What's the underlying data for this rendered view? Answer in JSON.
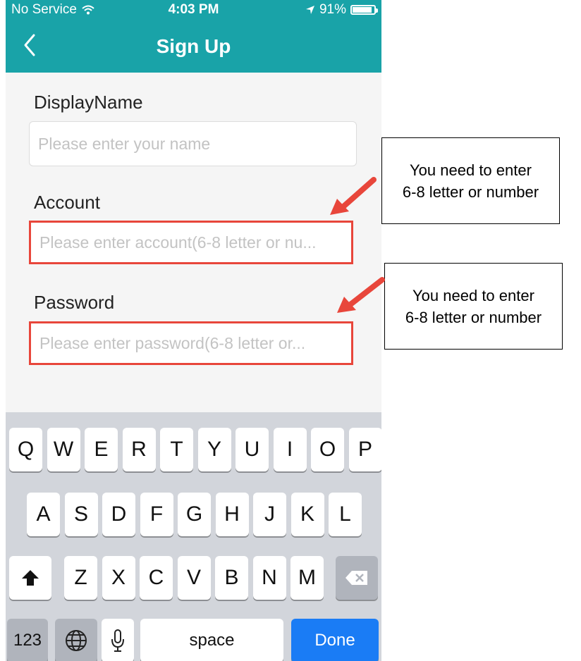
{
  "status_bar": {
    "carrier": "No Service",
    "time": "4:03 PM",
    "battery": "91%",
    "battery_level": 0.91
  },
  "nav": {
    "title": "Sign Up"
  },
  "form": {
    "display_name": {
      "label": "DisplayName",
      "placeholder": "Please enter your name"
    },
    "account": {
      "label": "Account",
      "placeholder": "Please enter account(6-8 letter or nu..."
    },
    "password": {
      "label": "Password",
      "placeholder": "Please enter password(6-8 letter or..."
    }
  },
  "keyboard": {
    "row1": [
      "Q",
      "W",
      "E",
      "R",
      "T",
      "Y",
      "U",
      "I",
      "O",
      "P"
    ],
    "row2": [
      "A",
      "S",
      "D",
      "F",
      "G",
      "H",
      "J",
      "K",
      "L"
    ],
    "row3": [
      "Z",
      "X",
      "C",
      "V",
      "B",
      "N",
      "M"
    ],
    "numbers_label": "123",
    "space_label": "space",
    "done_label": "Done"
  },
  "annotations": [
    {
      "line1": "You need to enter",
      "line2": "6-8 letter or number"
    },
    {
      "line1": "You need to enter",
      "line2": "6-8 letter or number"
    }
  ],
  "colors": {
    "header": "#19a3a8",
    "highlight": "#e8463b",
    "arrow": "#e8463b",
    "done": "#1a7cf5"
  }
}
